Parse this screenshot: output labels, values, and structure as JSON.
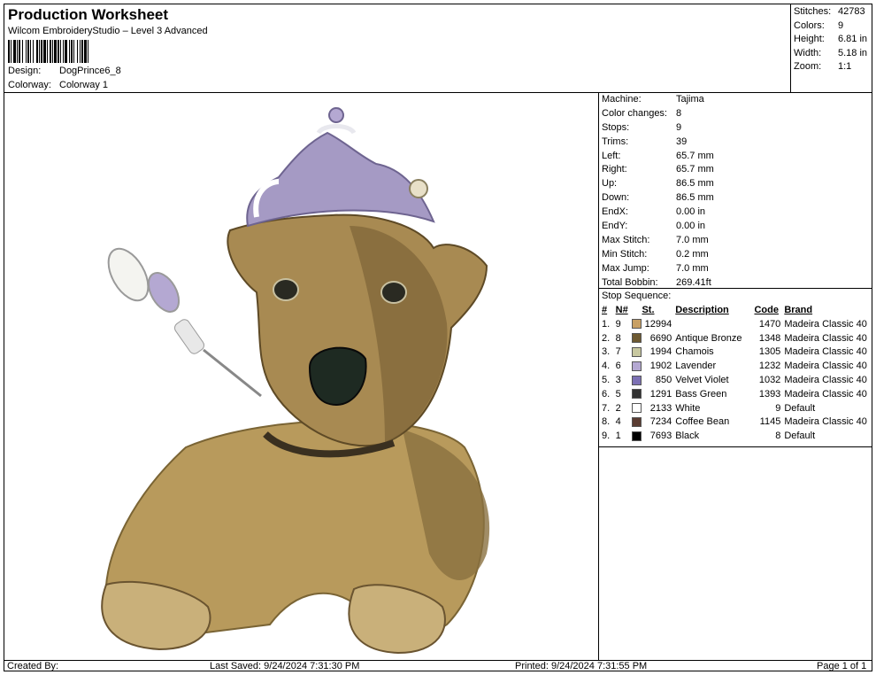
{
  "header": {
    "title": "Production Worksheet",
    "subtitle": "Wilcom EmbroideryStudio – Level 3 Advanced",
    "design_label": "Design:",
    "design_value": "DogPrince6_8",
    "colorway_label": "Colorway:",
    "colorway_value": "Colorway 1"
  },
  "summary": [
    {
      "label": "Stitches:",
      "value": "42783"
    },
    {
      "label": "Colors:",
      "value": "9"
    },
    {
      "label": "Height:",
      "value": "6.81 in"
    },
    {
      "label": "Width:",
      "value": "5.18 in"
    },
    {
      "label": "Zoom:",
      "value": "1:1"
    }
  ],
  "stats": [
    {
      "label": "Machine:",
      "value": "Tajima"
    },
    {
      "label": "Color changes:",
      "value": "8"
    },
    {
      "label": "Stops:",
      "value": "9"
    },
    {
      "label": "Trims:",
      "value": "39"
    },
    {
      "label": "Left:",
      "value": "65.7 mm"
    },
    {
      "label": "Right:",
      "value": "65.7 mm"
    },
    {
      "label": "Up:",
      "value": "86.5 mm"
    },
    {
      "label": "Down:",
      "value": "86.5 mm"
    },
    {
      "label": "EndX:",
      "value": "0.00 in"
    },
    {
      "label": "EndY:",
      "value": "0.00 in"
    },
    {
      "label": "Max Stitch:",
      "value": "7.0 mm"
    },
    {
      "label": "Min Stitch:",
      "value": "0.2 mm"
    },
    {
      "label": "Max Jump:",
      "value": "7.0 mm"
    },
    {
      "label": "Total Bobbin:",
      "value": "269.41ft"
    }
  ],
  "stop_sequence": {
    "title": "Stop Sequence:",
    "headers": {
      "idx": "#",
      "n": "N#",
      "st": "St.",
      "desc": "Description",
      "code": "Code",
      "brand": "Brand"
    },
    "rows": [
      {
        "idx": "1.",
        "n": "9",
        "color": "#c8a064",
        "st": "12994",
        "desc": "",
        "code": "1470",
        "brand": "Madeira Classic 40"
      },
      {
        "idx": "2.",
        "n": "8",
        "color": "#6e5a32",
        "st": "6690",
        "desc": "Antique Bronze",
        "code": "1348",
        "brand": "Madeira Classic 40"
      },
      {
        "idx": "3.",
        "n": "7",
        "color": "#c8c8a0",
        "st": "1994",
        "desc": "Chamois",
        "code": "1305",
        "brand": "Madeira Classic 40"
      },
      {
        "idx": "4.",
        "n": "6",
        "color": "#b4a8d2",
        "st": "1902",
        "desc": "Lavender",
        "code": "1232",
        "brand": "Madeira Classic 40"
      },
      {
        "idx": "5.",
        "n": "3",
        "color": "#7c70b4",
        "st": "850",
        "desc": "Velvet Violet",
        "code": "1032",
        "brand": "Madeira Classic 40"
      },
      {
        "idx": "6.",
        "n": "5",
        "color": "#323232",
        "st": "1291",
        "desc": "Bass Green",
        "code": "1393",
        "brand": "Madeira Classic 40"
      },
      {
        "idx": "7.",
        "n": "2",
        "color": "#ffffff",
        "st": "2133",
        "desc": "White",
        "code": "9",
        "brand": "Default"
      },
      {
        "idx": "8.",
        "n": "4",
        "color": "#5a3c32",
        "st": "7234",
        "desc": "Coffee Bean",
        "code": "1145",
        "brand": "Madeira Classic 40"
      },
      {
        "idx": "9.",
        "n": "1",
        "color": "#000000",
        "st": "7693",
        "desc": "Black",
        "code": "8",
        "brand": "Default"
      }
    ]
  },
  "footer": {
    "created_by": "Created By:",
    "last_saved": "Last Saved: 9/24/2024 7:31:30 PM",
    "printed": "Printed: 9/24/2024 7:31:55 PM",
    "page": "Page 1 of 1"
  }
}
